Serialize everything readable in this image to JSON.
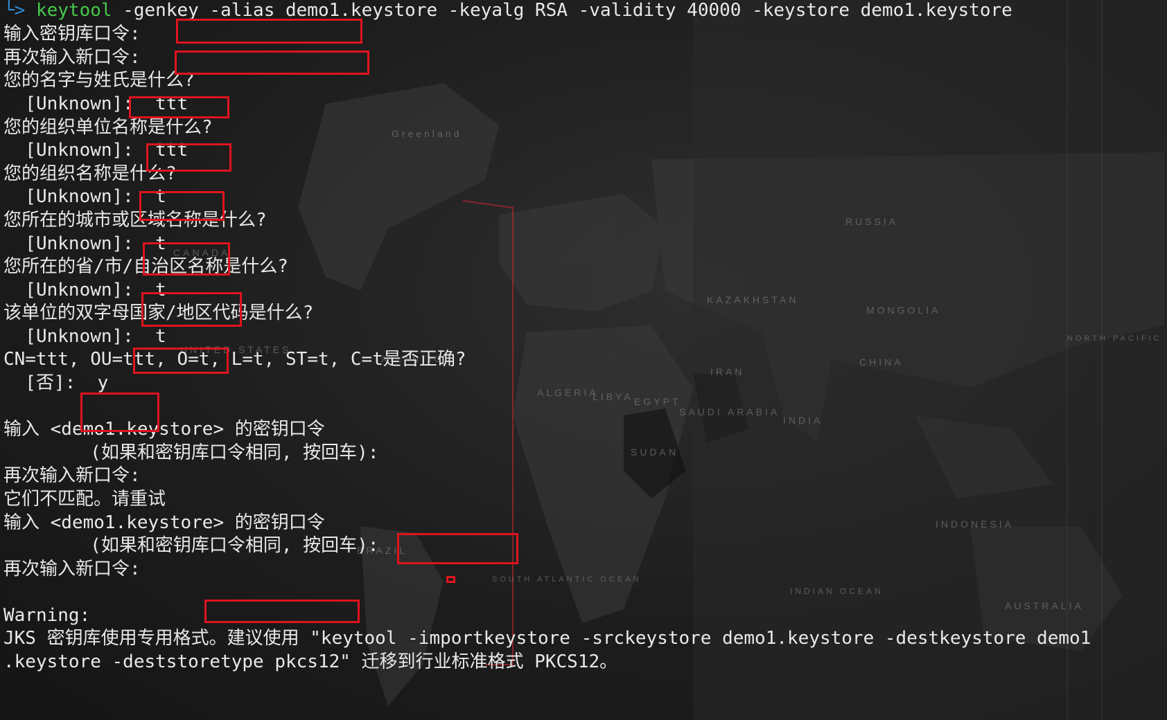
{
  "terminal": {
    "prompt_symbol": "└>",
    "command": {
      "name": "keytool",
      "args": " -genkey -alias demo1.keystore -keyalg RSA -validity 40000 -keystore demo1.keystore"
    },
    "lines": [
      "输入密钥库口令:",
      "再次输入新口令:",
      "您的名字与姓氏是什么?",
      "  [Unknown]:  ttt",
      "您的组织单位名称是什么?",
      "  [Unknown]:  ttt",
      "您的组织名称是什么?",
      "  [Unknown]:  t",
      "您所在的城市或区域名称是什么?",
      "  [Unknown]:  t",
      "您所在的省/市/自治区名称是什么?",
      "  [Unknown]:  t",
      "该单位的双字母国家/地区代码是什么?",
      "  [Unknown]:  t",
      "CN=ttt, OU=ttt, O=t, L=t, ST=t, C=t是否正确?",
      "  [否]:  y",
      "",
      "输入 <demo1.keystore> 的密钥口令",
      "        (如果和密钥库口令相同, 按回车):",
      "再次输入新口令:",
      "它们不匹配。请重试",
      "输入 <demo1.keystore> 的密钥口令",
      "        (如果和密钥库口令相同, 按回车):",
      "再次输入新口令:",
      "",
      "Warning:",
      "JKS 密钥库使用专用格式。建议使用 \"keytool -importkeystore -srckeystore demo1.keystore -destkeystore demo1",
      ".keystore -deststoretype pkcs12\" 迁移到行业标准格式 PKCS12。"
    ]
  },
  "background": {
    "map_labels": [
      "Greenland",
      "CANADA",
      "UNITED STATES",
      "RUSSIA",
      "KAZAKHSTAN",
      "MONGOLIA",
      "CHINA",
      "INDIA",
      "IRAN",
      "SAUDI ARABIA",
      "EGYPT",
      "LIBYA",
      "ALGERIA",
      "SUDAN",
      "INDONESIA",
      "AUSTRALIA",
      "BRAZIL",
      "NORTH PACIFIC OCEAN",
      "SOUTH ATLANTIC OCEAN",
      "INDIAN OCEAN",
      "ATLANTIC"
    ],
    "colors": {
      "terminal_bg": "#1f1f1f",
      "text": "#e9e9e9",
      "prompt": "#2f8bd6",
      "command": "#47c74a",
      "highlight": "#e0141e"
    }
  }
}
